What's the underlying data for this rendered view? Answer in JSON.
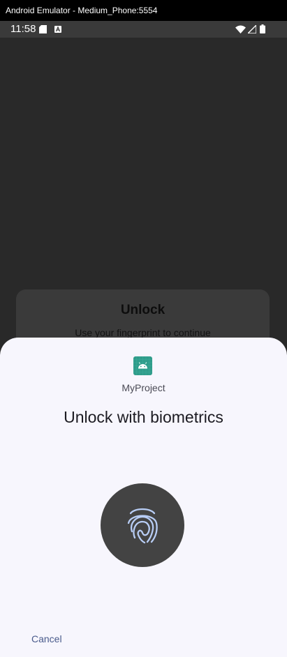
{
  "window": {
    "title": "Android Emulator - Medium_Phone:5554"
  },
  "status_bar": {
    "time": "11:58",
    "icons": [
      "sd-card-icon",
      "a-notification-icon",
      "wifi-icon",
      "signal-icon",
      "battery-icon"
    ]
  },
  "background_dialog": {
    "title": "Unlock",
    "subtitle": "Use your fingerprint to continue"
  },
  "biometric_sheet": {
    "app_icon": "android-robot-icon",
    "app_name": "MyProject",
    "title": "Unlock with biometrics",
    "fingerprint_icon": "fingerprint-icon",
    "cancel_label": "Cancel"
  },
  "colors": {
    "sheet_background": "#f7f6fd",
    "app_icon_background": "#2f9c8a",
    "fingerprint_circle": "#434343",
    "fingerprint_stroke": "#b8cdf5",
    "cancel_text": "#4a5b8c"
  }
}
